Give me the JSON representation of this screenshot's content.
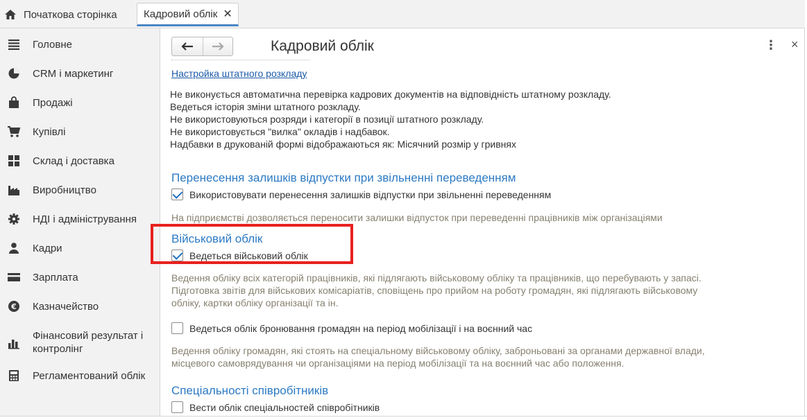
{
  "tabs": {
    "home_label": "Початкова сторінка",
    "active_label": "Кадровий облік",
    "close_glyph": "✕"
  },
  "sidebar": {
    "items": [
      {
        "label": "Головне",
        "icon": "menu-icon"
      },
      {
        "label": "CRM і маркетинг",
        "icon": "pie-chart-icon"
      },
      {
        "label": "Продажі",
        "icon": "shopping-bag-icon"
      },
      {
        "label": "Купівлі",
        "icon": "shopping-cart-icon"
      },
      {
        "label": "Склад і доставка",
        "icon": "warehouse-grid-icon"
      },
      {
        "label": "Виробництво",
        "icon": "factory-icon"
      },
      {
        "label": "НДІ і адміністрування",
        "icon": "gear-icon"
      },
      {
        "label": "Кадри",
        "icon": "person-icon"
      },
      {
        "label": "Зарплата",
        "icon": "wallet-card-icon"
      },
      {
        "label": "Казначейство",
        "icon": "treasury-coin-icon"
      },
      {
        "label": "Фінансовий результат і контролінг",
        "icon": "bar-chart-icon"
      },
      {
        "label": "Регламентований облік",
        "icon": "calculator-icon"
      }
    ]
  },
  "header": {
    "back_glyph": "🡐",
    "forward_glyph": "🡒",
    "title": "Кадровий облік",
    "more_glyph": "⋮",
    "close_glyph": "×"
  },
  "staffing": {
    "link_label": "Настройка штатного розкладу",
    "lines": [
      "Не виконується автоматична перевірка кадрових документів на відповідність штатному розкладу.",
      "Ведеться історія зміни штатного розкладу.",
      "Не використовуються розряди і категорії в позиції штатного розкладу.",
      "Не використовується \"вилка\" окладів і надбавок.",
      "Надбавки в друкованій формі відображаються як: Місячний розмір у гривнях"
    ]
  },
  "vacation_transfer": {
    "title": "Перенесення залишків відпустки при звільненні переведенням",
    "checkbox_label": "Використовувати перенесення залишків відпустки при звільненні переведенням",
    "checked": true,
    "note": "На підприємстві дозволяється переносити залишки відпусток при переведенні працівників між організаціями"
  },
  "military": {
    "title": "Військовий облік",
    "checkbox_label": "Ведеться військовий облік",
    "checked": true,
    "note_lines": [
      "Ведення обліку всіх категорій працівників, які підлягають військовому обліку та працівників, що перебувають у запасі.",
      "Підготовка звітів для військових комісаріатів, сповіщень про прийом на роботу громадян, які підлягають військовому",
      "обліку, картки обліку організації та ін."
    ],
    "reservation_label": "Ведеться облік бронювання громадян на період мобілізації і на воєнний час",
    "reservation_checked": false,
    "reservation_note_lines": [
      "Ведення обліку громадян, які стоять на спеціальному військовому обліку, заброньовані за органами державної влади,",
      "місцевого самоврядування чи організаціями на період мобілізації та на воєнний час або положення."
    ]
  },
  "specialties": {
    "title": "Спеціальності співробітників",
    "checkbox_label": "Вести облік спеціальностей співробітників",
    "checked": false
  },
  "colors": {
    "accent_blue": "#2c7ac4",
    "link_blue": "#1c5aa8",
    "note_text": "#85806f",
    "highlight_red": "#e8211f",
    "checkmark_blue": "#1f6fc2"
  }
}
